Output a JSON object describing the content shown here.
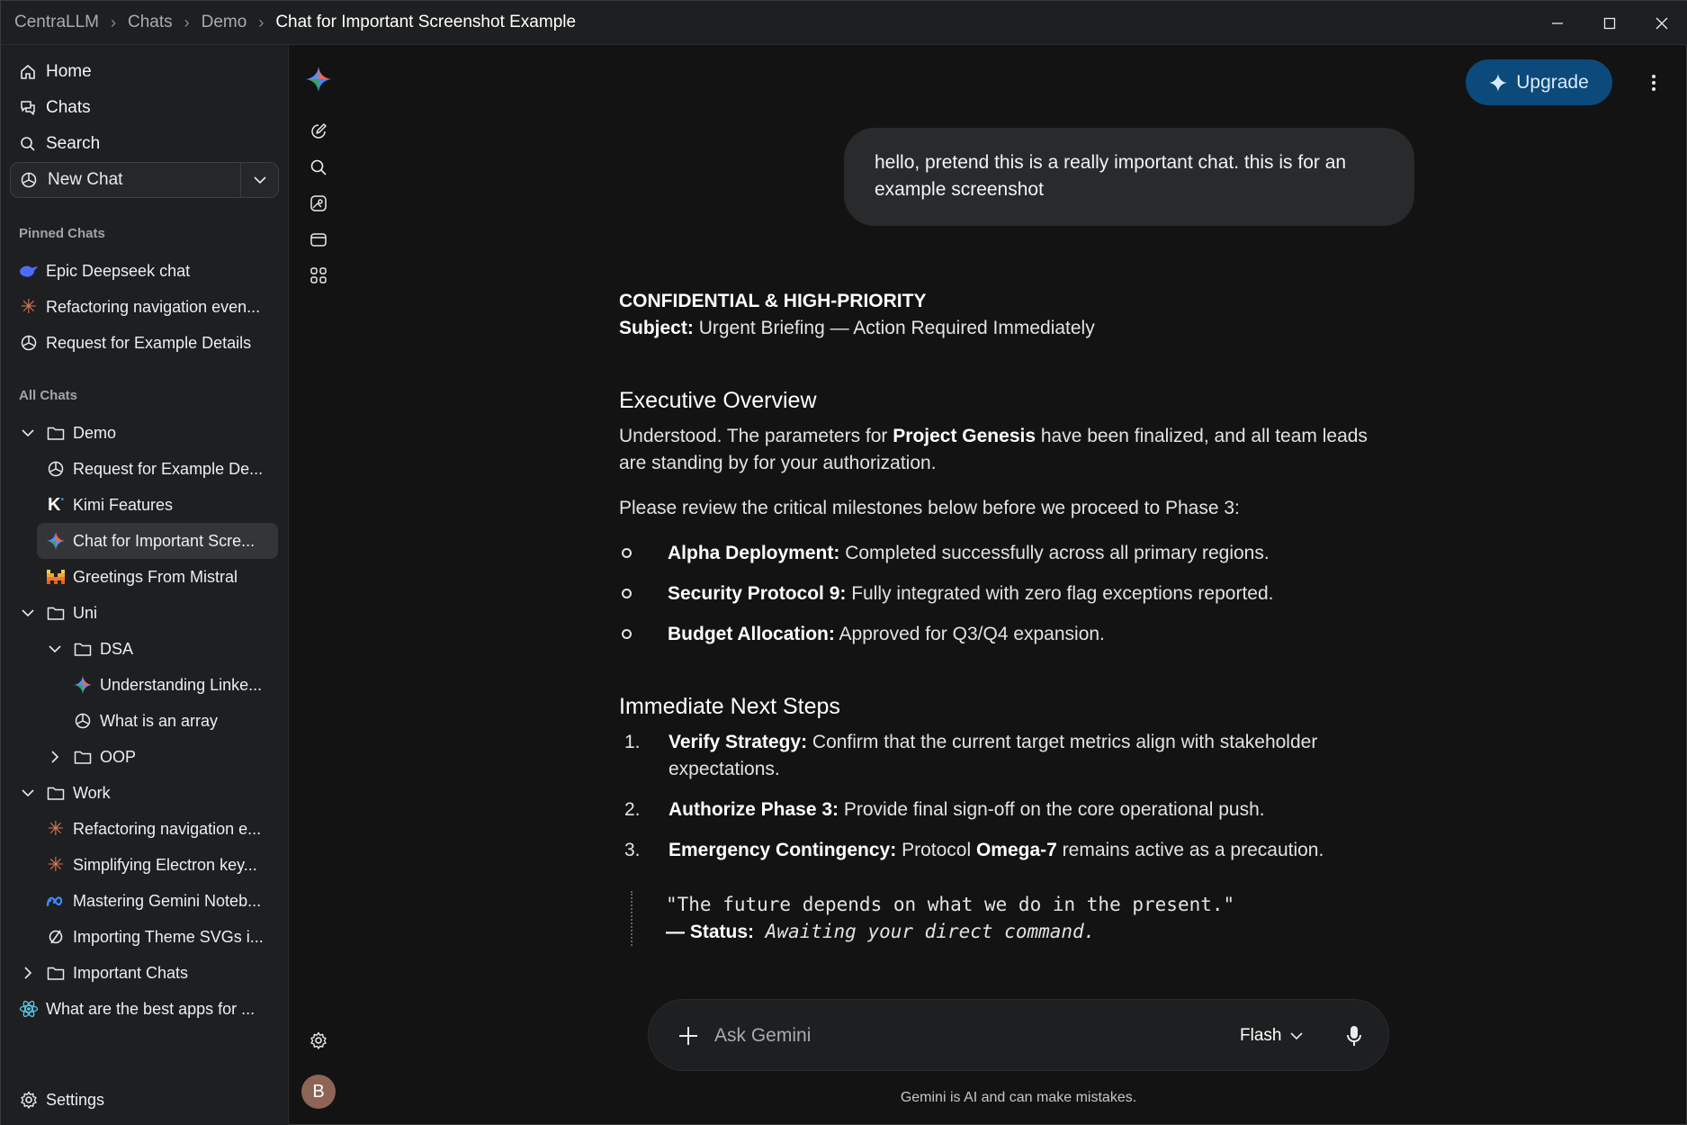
{
  "breadcrumb": [
    "CentraLLM",
    "Chats",
    "Demo",
    "Chat for Important Screenshot Example"
  ],
  "sidebar": {
    "nav": [
      {
        "label": "Home",
        "icon": "home-icon"
      },
      {
        "label": "Chats",
        "icon": "chats-icon"
      },
      {
        "label": "Search",
        "icon": "search-icon"
      }
    ],
    "new_chat": "New Chat",
    "pinned_title": "Pinned Chats",
    "pinned": [
      {
        "label": "Epic Deepseek chat",
        "icon": "deepseek-icon"
      },
      {
        "label": "Refactoring navigation even...",
        "icon": "claude-icon"
      },
      {
        "label": "Request for Example Details",
        "icon": "openai-icon"
      }
    ],
    "all_title": "All Chats",
    "tree": [
      {
        "label": "Demo",
        "type": "folder",
        "expanded": true
      },
      {
        "label": "Request for Example De...",
        "icon": "openai-icon"
      },
      {
        "label": "Kimi Features",
        "icon": "kimi-icon"
      },
      {
        "label": "Chat for Important Scre...",
        "icon": "gemini-icon",
        "active": true
      },
      {
        "label": "Greetings From Mistral",
        "icon": "mistral-icon"
      },
      {
        "label": "Uni",
        "type": "folder",
        "expanded": true
      },
      {
        "label": "DSA",
        "type": "folder",
        "expanded": true
      },
      {
        "label": "Understanding Linke...",
        "icon": "gemini-icon"
      },
      {
        "label": "What is an array",
        "icon": "openai-icon"
      },
      {
        "label": "OOP",
        "type": "folder",
        "expanded": false
      },
      {
        "label": "Work",
        "type": "folder",
        "expanded": true
      },
      {
        "label": "Refactoring navigation e...",
        "icon": "claude-icon"
      },
      {
        "label": "Simplifying Electron key...",
        "icon": "claude-icon"
      },
      {
        "label": "Mastering Gemini Noteb...",
        "icon": "meta-icon"
      },
      {
        "label": "Importing Theme SVGs i...",
        "icon": "perplexity-icon"
      },
      {
        "label": "Important Chats",
        "type": "folder",
        "expanded": false
      },
      {
        "label": "What are the best apps for ...",
        "icon": "react-icon"
      }
    ],
    "settings": "Settings"
  },
  "rail": {
    "avatar_letter": "B"
  },
  "header": {
    "upgrade": "Upgrade"
  },
  "chat": {
    "user_message": "hello, pretend this is a really important chat. this is for an example screenshot",
    "response": {
      "title": "CONFIDENTIAL & HIGH-PRIORITY",
      "subject_label": "Subject:",
      "subject": "Urgent Briefing — Action Required Immediately",
      "h_overview": "Executive Overview",
      "p1_a": "Understood. The parameters for ",
      "p1_b": "Project Genesis",
      "p1_c": " have been finalized, and all team leads are standing by for your authorization.",
      "p2": "Please review the critical milestones below before we proceed to Phase 3:",
      "bullets": [
        {
          "label": "Alpha Deployment:",
          "text": " Completed successfully across all primary regions."
        },
        {
          "label": "Security Protocol 9:",
          "text": " Fully integrated with zero flag exceptions reported."
        },
        {
          "label": "Budget Allocation:",
          "text": " Approved for Q3/Q4 expansion."
        }
      ],
      "h_steps": "Immediate Next Steps",
      "steps": [
        {
          "num": "1.",
          "label": "Verify Strategy:",
          "text": " Confirm that the current target metrics align with stakeholder expectations."
        },
        {
          "num": "2.",
          "label": "Authorize Phase 3:",
          "text": " Provide final sign-off on the core operational push."
        },
        {
          "num": "3.",
          "label": "Emergency Contingency:",
          "text": " Protocol ",
          "bold2": "Omega-7",
          "text2": " remains active as a precaution."
        }
      ],
      "quote": "\"The future depends on what we do in the present.\"",
      "status_dash": "— Status:",
      "status_text": "Awaiting your direct command."
    }
  },
  "input": {
    "placeholder": "Ask Gemini",
    "model": "Flash",
    "disclaimer": "Gemini is AI and can make mistakes."
  },
  "colors": {
    "accent": "#0b4a7a",
    "background": "#131314",
    "sidebar": "#1e1f20"
  }
}
